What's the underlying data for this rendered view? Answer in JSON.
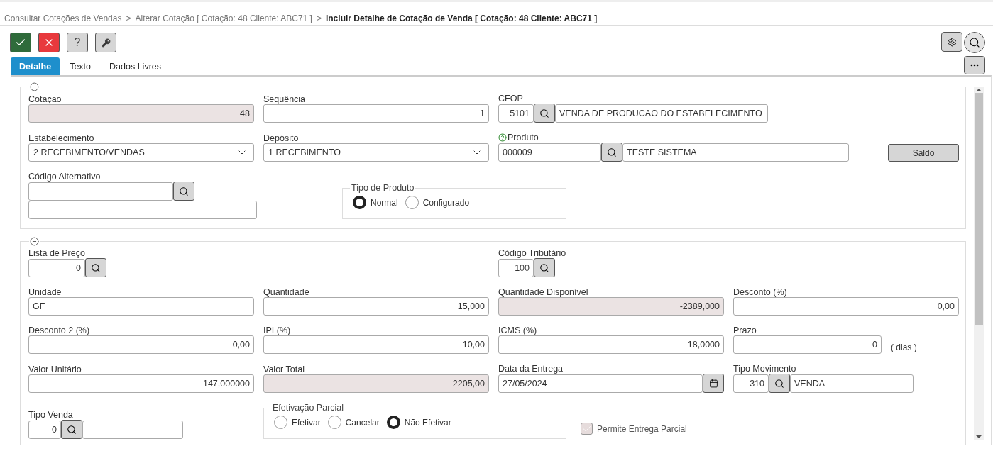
{
  "breadcrumb": [
    {
      "kind": "link",
      "text": "Consultar Cotações de Vendas"
    },
    {
      "kind": "separator",
      "text": ">"
    },
    {
      "kind": "link",
      "text": "Alterar Cotação [ Cotação: 48 Cliente: ABC71 ]"
    },
    {
      "kind": "separator",
      "text": ">"
    },
    {
      "kind": "current",
      "text": "Incluir Detalhe de Cotação de Venda [ Cotação: 48 Cliente: ABC71 ]"
    }
  ],
  "toolbar": [
    {
      "kind": "confirm"
    },
    {
      "kind": "cancel"
    },
    {
      "kind": "help",
      "label": "?"
    },
    {
      "kind": "tools"
    }
  ],
  "tabs": [
    {
      "label": "Detalhe",
      "selected": true
    },
    {
      "label": "Texto",
      "selected": false
    },
    {
      "label": "Dados Livres",
      "selected": false
    }
  ],
  "sections": [
    {
      "expanded": true,
      "rows": [
        {
          "fields": [
            {
              "kind": "number",
              "label": "Cotação",
              "value": "48",
              "readonly": true
            },
            {
              "kind": "number",
              "label": "Sequência",
              "value": "1",
              "readonly": false
            },
            {
              "kind": "lookup",
              "label": "CFOP",
              "code": "5101",
              "description": "VENDA DE PRODUCAO DO ESTABELECIMENTO",
              "help": false
            }
          ]
        },
        {
          "fields": [
            {
              "kind": "select",
              "label": "Estabelecimento",
              "value": "2 RECEBIMENTO/VENDAS"
            },
            {
              "kind": "select",
              "label": "Depósito",
              "value": "1 RECEBIMENTO"
            },
            {
              "kind": "lookup",
              "label": "Produto",
              "code": "000009",
              "description": "TESTE SISTEMA",
              "help": true
            },
            {
              "kind": "button",
              "label": "Saldo"
            }
          ]
        },
        {
          "fields": [
            {
              "kind": "lookup",
              "label": "Código Alternativo",
              "help": false
            },
            {
              "kind": "radio",
              "label": "Tipo de Produto",
              "options": [
                {
                  "label": "Normal",
                  "selected": true
                },
                {
                  "label": "Configurado",
                  "selected": false
                }
              ]
            }
          ]
        }
      ]
    },
    {
      "expanded": true,
      "rows": [
        {
          "fields": [
            {
              "kind": "lookup",
              "label": "Lista de Preço",
              "code": "0",
              "help": false
            },
            {
              "kind": "lookup",
              "label": "Código Tributário",
              "code": "100",
              "help": false
            }
          ]
        },
        {
          "fields": [
            {
              "kind": "text",
              "label": "Unidade",
              "value": "GF",
              "readonly": false
            },
            {
              "kind": "number",
              "label": "Quantidade",
              "value": "15,000",
              "readonly": false
            },
            {
              "kind": "number",
              "label": "Quantidade Disponível",
              "value": "-2389,000",
              "readonly": true
            },
            {
              "kind": "number",
              "label": "Desconto (%)",
              "value": "0,00",
              "readonly": false
            }
          ]
        },
        {
          "fields": [
            {
              "kind": "number",
              "label": "Desconto 2 (%)",
              "value": "0,00",
              "readonly": false
            },
            {
              "kind": "number",
              "label": "IPI (%)",
              "value": "10,00",
              "readonly": false
            },
            {
              "kind": "number",
              "label": "ICMS (%)",
              "value": "18,0000",
              "readonly": false
            },
            {
              "kind": "number",
              "label": "Prazo",
              "value": "0",
              "readonly": false,
              "suffix": "( dias )"
            }
          ]
        },
        {
          "fields": [
            {
              "kind": "number",
              "label": "Valor Unitário",
              "value": "147,000000",
              "readonly": false
            },
            {
              "kind": "number",
              "label": "Valor Total",
              "value": "2205,00",
              "readonly": true
            },
            {
              "kind": "date",
              "label": "Data da Entrega",
              "value": "27/05/2024"
            },
            {
              "kind": "lookup",
              "label": "Tipo Movimento",
              "code": "310",
              "description": "VENDA",
              "help": false
            }
          ]
        },
        {
          "fields": [
            {
              "kind": "lookup",
              "label": "Tipo Venda",
              "code": "0",
              "help": false
            },
            {
              "kind": "radio",
              "label": "Efetivação Parcial",
              "options": [
                {
                  "label": "Efetivar",
                  "selected": false
                },
                {
                  "label": "Cancelar",
                  "selected": false
                },
                {
                  "label": "Não Efetivar",
                  "selected": true
                }
              ]
            },
            {
              "kind": "checkbox",
              "label": "Permite Entrega Parcial",
              "checked": true,
              "disabled": true
            }
          ]
        }
      ]
    }
  ]
}
